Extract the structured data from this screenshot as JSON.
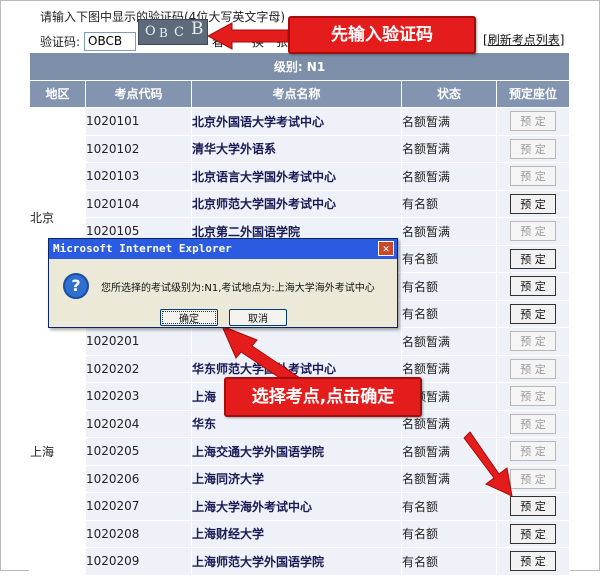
{
  "form": {
    "hint": "请输入下图中显示的验证码(4位大写英文字母)",
    "captcha_label": "验证码:",
    "captcha_value": "OBCB",
    "captcha_image_chars": [
      "O",
      "B",
      "C",
      "B"
    ],
    "covered_link_fragment": "看",
    "covered_link_fragment_2": "换一张",
    "refresh_link": "刷新考点列表"
  },
  "table": {
    "level_label": "级别: N1",
    "headers": [
      "地区",
      "考点代码",
      "考点名称",
      "状态",
      "预定座位"
    ],
    "book_label": "预 定",
    "regions": [
      {
        "name": "北京",
        "rows": [
          {
            "code": "1020101",
            "name": "北京外国语大学考试中心",
            "status": "名额暂满",
            "bookable": false
          },
          {
            "code": "1020102",
            "name": "清华大学外语系",
            "status": "名额暂满",
            "bookable": false
          },
          {
            "code": "1020103",
            "name": "北京语言大学国外考试中心",
            "status": "名额暂满",
            "bookable": false
          },
          {
            "code": "1020104",
            "name": "北京师范大学国外考试中心",
            "status": "有名额",
            "bookable": true
          },
          {
            "code": "1020105",
            "name": "北京第二外国语学院",
            "status": "名额暂满",
            "bookable": false
          },
          {
            "code": "",
            "name": "",
            "status": "有名额",
            "bookable": true
          },
          {
            "code": "",
            "name": "",
            "status": "有名额",
            "bookable": true
          },
          {
            "code": "",
            "name": "",
            "status": "有名额",
            "bookable": true
          }
        ]
      },
      {
        "name": "上海",
        "rows": [
          {
            "code": "1020201",
            "name": "",
            "status": "名额暂满",
            "bookable": false
          },
          {
            "code": "1020202",
            "name": "华东师范大学国外考试中心",
            "status": "名额暂满",
            "bookable": false
          },
          {
            "code": "1020203",
            "name": "上海",
            "status": "名额暂满",
            "bookable": false
          },
          {
            "code": "1020204",
            "name": "华东",
            "status": "名额暂满",
            "bookable": false
          },
          {
            "code": "1020205",
            "name": "上海交通大学外国语学院",
            "status": "名额暂满",
            "bookable": false
          },
          {
            "code": "1020206",
            "name": "上海同济大学",
            "status": "名额暂满",
            "bookable": false
          },
          {
            "code": "1020207",
            "name": "上海大学海外考试中心",
            "status": "有名额",
            "bookable": true
          },
          {
            "code": "1020208",
            "name": "上海财经大学",
            "status": "有名额",
            "bookable": true
          },
          {
            "code": "1020209",
            "name": "上海师范大学外国语学院",
            "status": "有名额",
            "bookable": true
          }
        ]
      }
    ]
  },
  "dialog": {
    "title": "Microsoft Internet Explorer",
    "close_glyph": "✕",
    "icon_glyph": "?",
    "message": "您所选择的考试级别为:N1,考试地点为:上海大学海外考试中心",
    "ok_label": "确定",
    "cancel_label": "取消"
  },
  "callouts": {
    "step1": "先输入验证码",
    "step2": "选择考点,点击确定"
  },
  "colors": {
    "callout_red": "#e51c1c",
    "table_header": "#8294b0",
    "dialog_title_blue": "#2b5be0"
  }
}
